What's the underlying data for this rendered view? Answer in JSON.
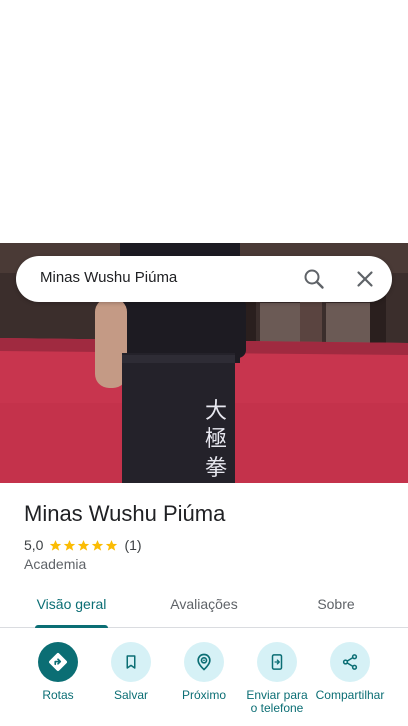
{
  "search": {
    "query": "Minas Wushu Piúma",
    "search_icon": "search-icon",
    "close_icon": "close-icon"
  },
  "photo": {
    "subject": "person in black kung fu uniform on red mat"
  },
  "place": {
    "title": "Minas Wushu Piúma",
    "rating": "5,0",
    "stars": 5,
    "review_count": "(1)",
    "category": "Academia"
  },
  "tabs": [
    {
      "label": "Visão geral",
      "active": true
    },
    {
      "label": "Avaliações",
      "active": false
    },
    {
      "label": "Sobre",
      "active": false
    }
  ],
  "actions": [
    {
      "label": "Rotas",
      "icon": "directions-icon"
    },
    {
      "label": "Salvar",
      "icon": "bookmark-icon"
    },
    {
      "label": "Próximo",
      "icon": "nearby-icon"
    },
    {
      "label": "Enviar para o telefone",
      "icon": "send-to-phone-icon"
    },
    {
      "label": "Compartilhar",
      "icon": "share-icon"
    }
  ],
  "colors": {
    "accent": "#0b6e74",
    "action_bg": "#d6f1f6",
    "star": "#fbbc04",
    "mat": "#c8354e"
  }
}
